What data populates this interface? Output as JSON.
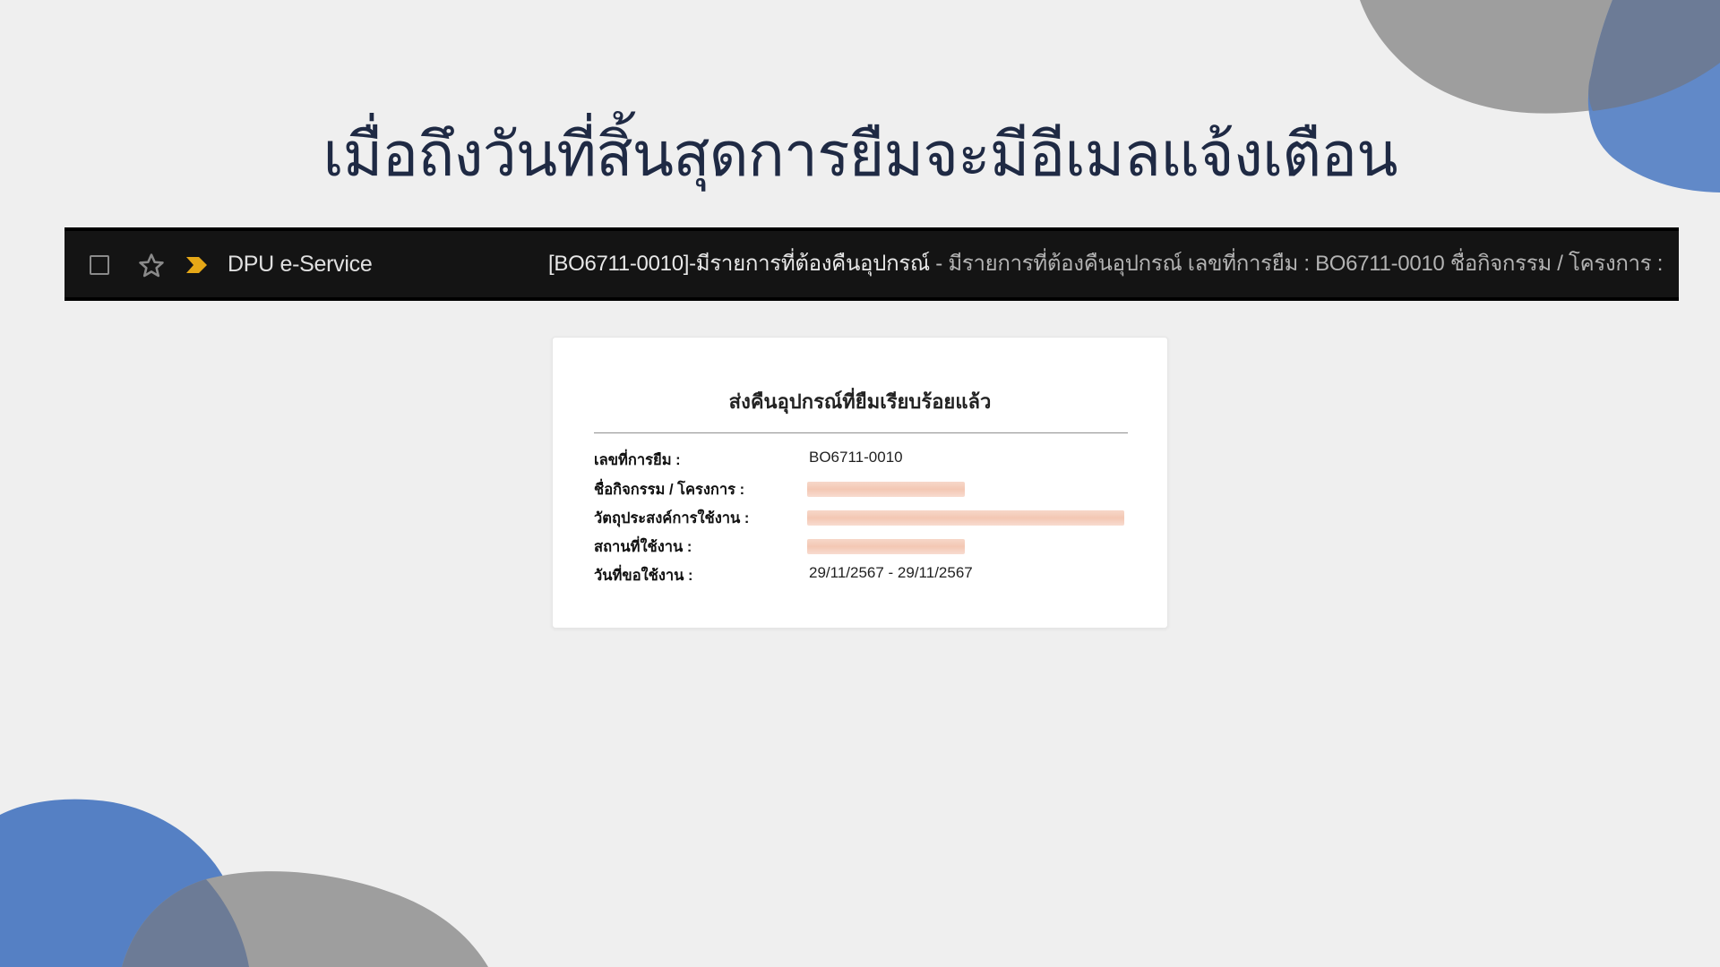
{
  "slide": {
    "headline": "เมื่อถึงวันที่สิ้นสุดการยืมจะมีอีเมลแจ้งเตือน",
    "colors": {
      "background": "#efefef",
      "blob_blue": "#5580c4",
      "blob_gray": "#9e9e9e",
      "headline": "#1f2a44"
    }
  },
  "inbox_row": {
    "checkbox_icon": "checkbox-icon",
    "star_icon": "star-outline-icon",
    "importance_icon": "importance-marker-icon",
    "importance_color": "#e6a817",
    "sender": "DPU e-Service",
    "subject": "[BO6711-0010]-มีรายการที่ต้องคืนอุปกรณ์",
    "separator": " - ",
    "snippet": "มีรายการที่ต้องคืนอุปกรณ์ เลขที่การยืม : BO6711-0010 ชื่อกิจกรรม / โครงการ : "
  },
  "email": {
    "title": "ส่งคืนอุปกรณ์ที่ยืมเรียบร้อยแล้ว",
    "details": [
      {
        "label": "เลขที่การยืม :",
        "value": "BO6711-0010"
      },
      {
        "label": "ชื่อกิจกรรม / โครงการ :",
        "value": ""
      },
      {
        "label": "วัตถุประสงค์การใช้งาน :",
        "value": ""
      },
      {
        "label": "สถานที่ใช้งาน :",
        "value": ""
      },
      {
        "label": "วันที่ขอใช้งาน :",
        "value": "29/11/2567 - 29/11/2567"
      }
    ]
  }
}
